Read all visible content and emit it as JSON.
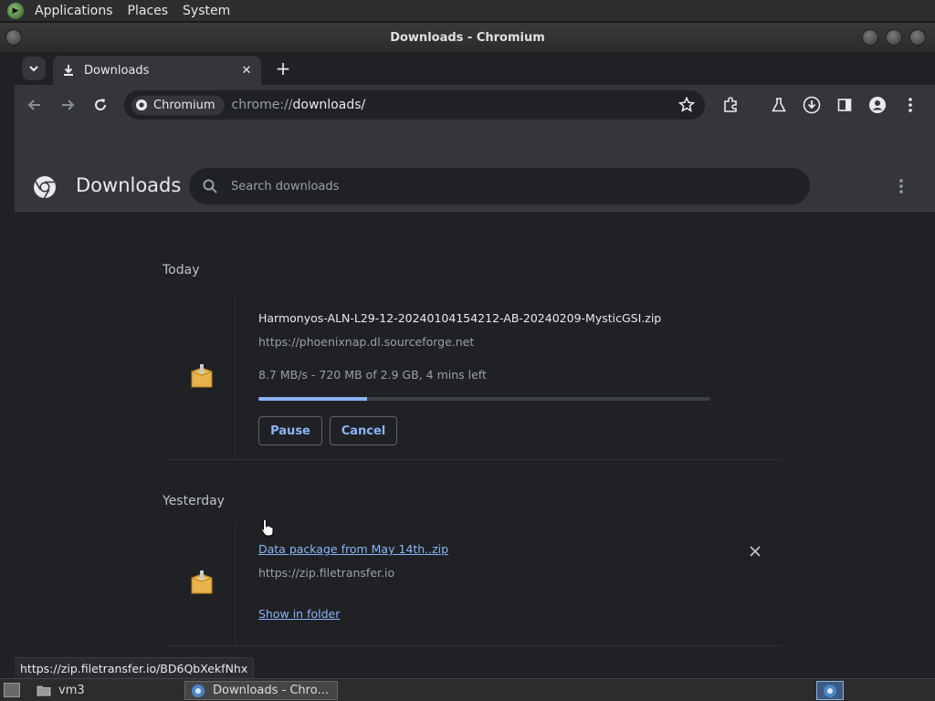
{
  "top_panel": {
    "menus": [
      "Applications",
      "Places",
      "System"
    ]
  },
  "window": {
    "title": "Downloads - Chromium"
  },
  "browser": {
    "tab": {
      "title": "Downloads"
    },
    "omnibox": {
      "chip_label": "Chromium",
      "url_scheme": "chrome://",
      "url_path": "downloads/"
    }
  },
  "downloads_page": {
    "title": "Downloads",
    "search_placeholder": "Search downloads",
    "sections": [
      {
        "label": "Today",
        "items": [
          {
            "file_name": "Harmonyos-ALN-L29-12-20240104154212-AB-20240209-MysticGSI.zip",
            "source_url": "https://phoenixnap.dl.sourceforge.net",
            "status": "8.7 MB/s - 720 MB of 2.9 GB, 4 mins left",
            "progress_fraction": 0.24,
            "buttons": [
              "Pause",
              "Cancel"
            ]
          }
        ]
      },
      {
        "label": "Yesterday",
        "items": [
          {
            "file_name": "Data package from May 14th..zip",
            "source_url": "https://zip.filetransfer.io",
            "action_link": "Show in folder"
          }
        ]
      }
    ]
  },
  "status_bar_url": "https://zip.filetransfer.io/BD6QbXekfNhx",
  "taskbar": {
    "items": [
      "vm3",
      "Downloads - Chro..."
    ]
  },
  "colors": {
    "accent": "#8ab4f8",
    "background": "#202124",
    "toolbar": "#35363a"
  }
}
